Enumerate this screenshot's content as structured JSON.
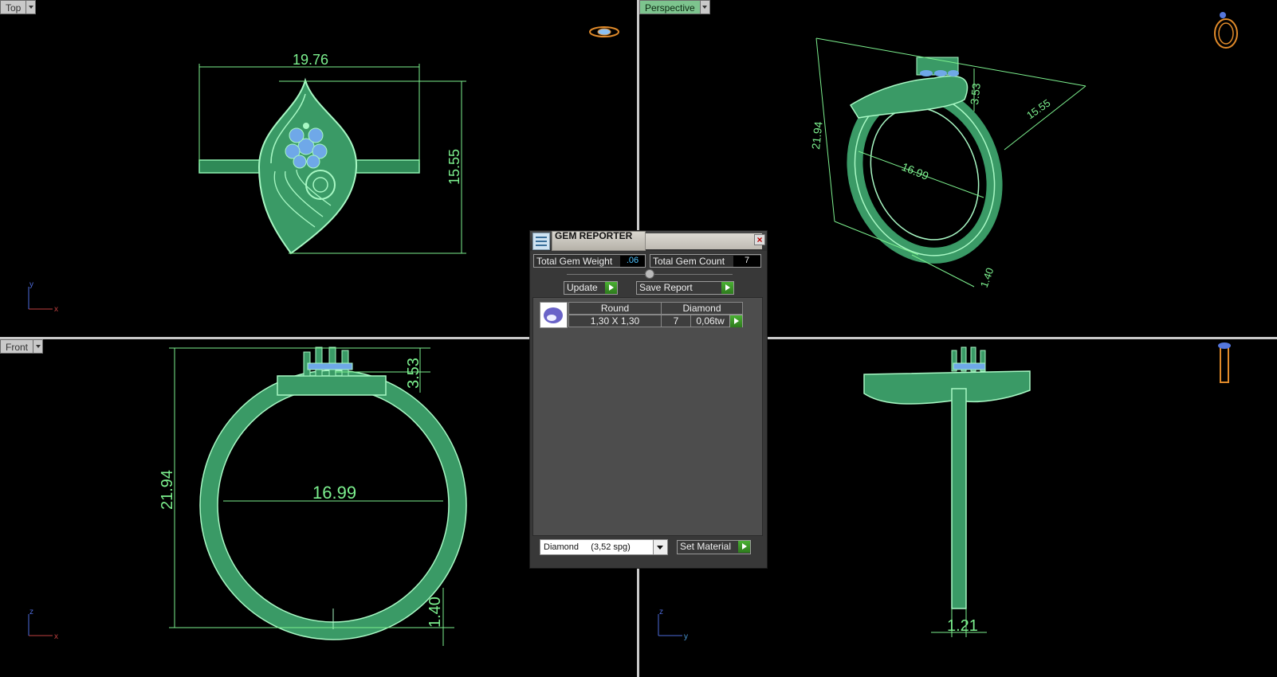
{
  "viewports": {
    "top": {
      "label": "Top",
      "dims": {
        "width": "19.76",
        "height": "15.55"
      },
      "axes": {
        "a": "y",
        "b": "x"
      }
    },
    "perspective": {
      "label": "Perspective",
      "dims": {
        "height": "21.94",
        "top": "3.53",
        "depth": "15.55",
        "inner": "16.99",
        "band": "1.40"
      }
    },
    "front": {
      "label": "Front",
      "dims": {
        "height": "21.94",
        "top": "3.53",
        "inner": "16.99",
        "band": "1.40"
      },
      "axes": {
        "a": "z",
        "b": "x"
      }
    },
    "right": {
      "dims": {
        "band_width": "1.21"
      },
      "axes": {
        "a": "z",
        "b": "y"
      }
    }
  },
  "gem_reporter": {
    "title": "GEM REPORTER",
    "total_weight_label": "Total Gem Weight",
    "total_weight_value": ".06",
    "total_count_label": "Total Gem Count",
    "total_count_value": "7",
    "update_label": "Update",
    "save_report_label": "Save Report",
    "table": {
      "shape": "Round",
      "material": "Diamond",
      "size": "1,30 X 1,30",
      "count": "7",
      "weight": "0,06tw"
    },
    "material_select": "Diamond     (3,52 spg)",
    "set_material_label": "Set Material"
  },
  "colors": {
    "accent": "#7cf08e",
    "ring": "#3a9a66",
    "gem": "#6fa8e8"
  }
}
